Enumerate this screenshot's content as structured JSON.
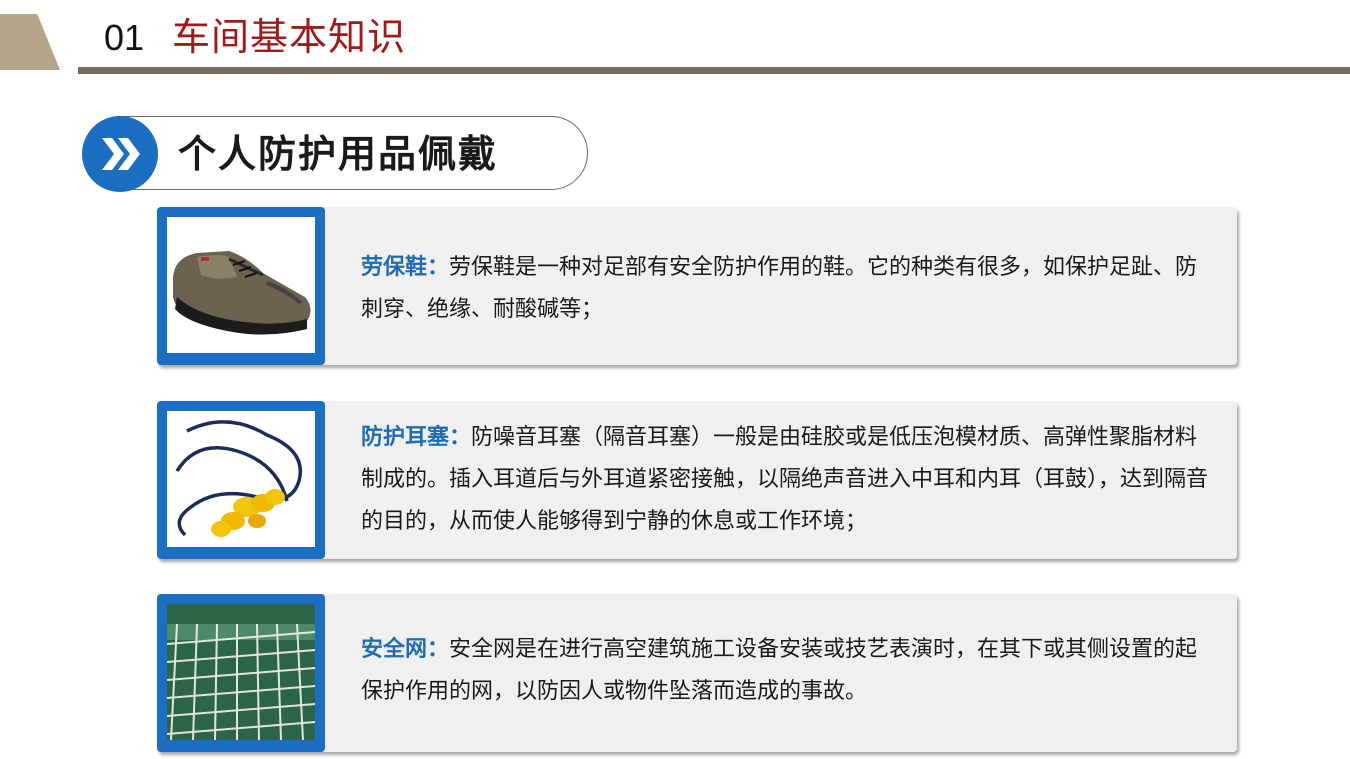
{
  "header": {
    "number": "01",
    "chapter_title": "车间基本知识"
  },
  "section": {
    "title": "个人防护用品佩戴",
    "icon": "double-chevron-right-icon"
  },
  "items": [
    {
      "term": "劳保鞋：",
      "description": "劳保鞋是一种对足部有安全防护作用的鞋。它的种类有很多，如保护足趾、防刺穿、绝缘、耐酸碱等；",
      "image": "safety-shoe"
    },
    {
      "term": "防护耳塞：",
      "description": "防噪音耳塞（隔音耳塞）一般是由硅胶或是低压泡模材质、高弹性聚脂材料制成的。插入耳道后与外耳道紧密接触，以隔绝声音进入中耳和内耳（耳鼓），达到隔音的目的，从而使人能够得到宁静的休息或工作环境；",
      "image": "corded-earplugs"
    },
    {
      "term": "安全网：",
      "description": "安全网是在进行高空建筑施工设备安装或技艺表演时，在其下或其侧设置的起保护作用的网，以防因人或物件坠落而造成的事故。",
      "image": "safety-net"
    }
  ],
  "colors": {
    "accent_blue": "#1b6ec2",
    "term_blue": "#1f6cb5",
    "chapter_red": "#a01a1a",
    "rule_brown": "#7a6a5c",
    "corner_tan": "#b5a58a",
    "card_bg": "#f0f0f0"
  }
}
